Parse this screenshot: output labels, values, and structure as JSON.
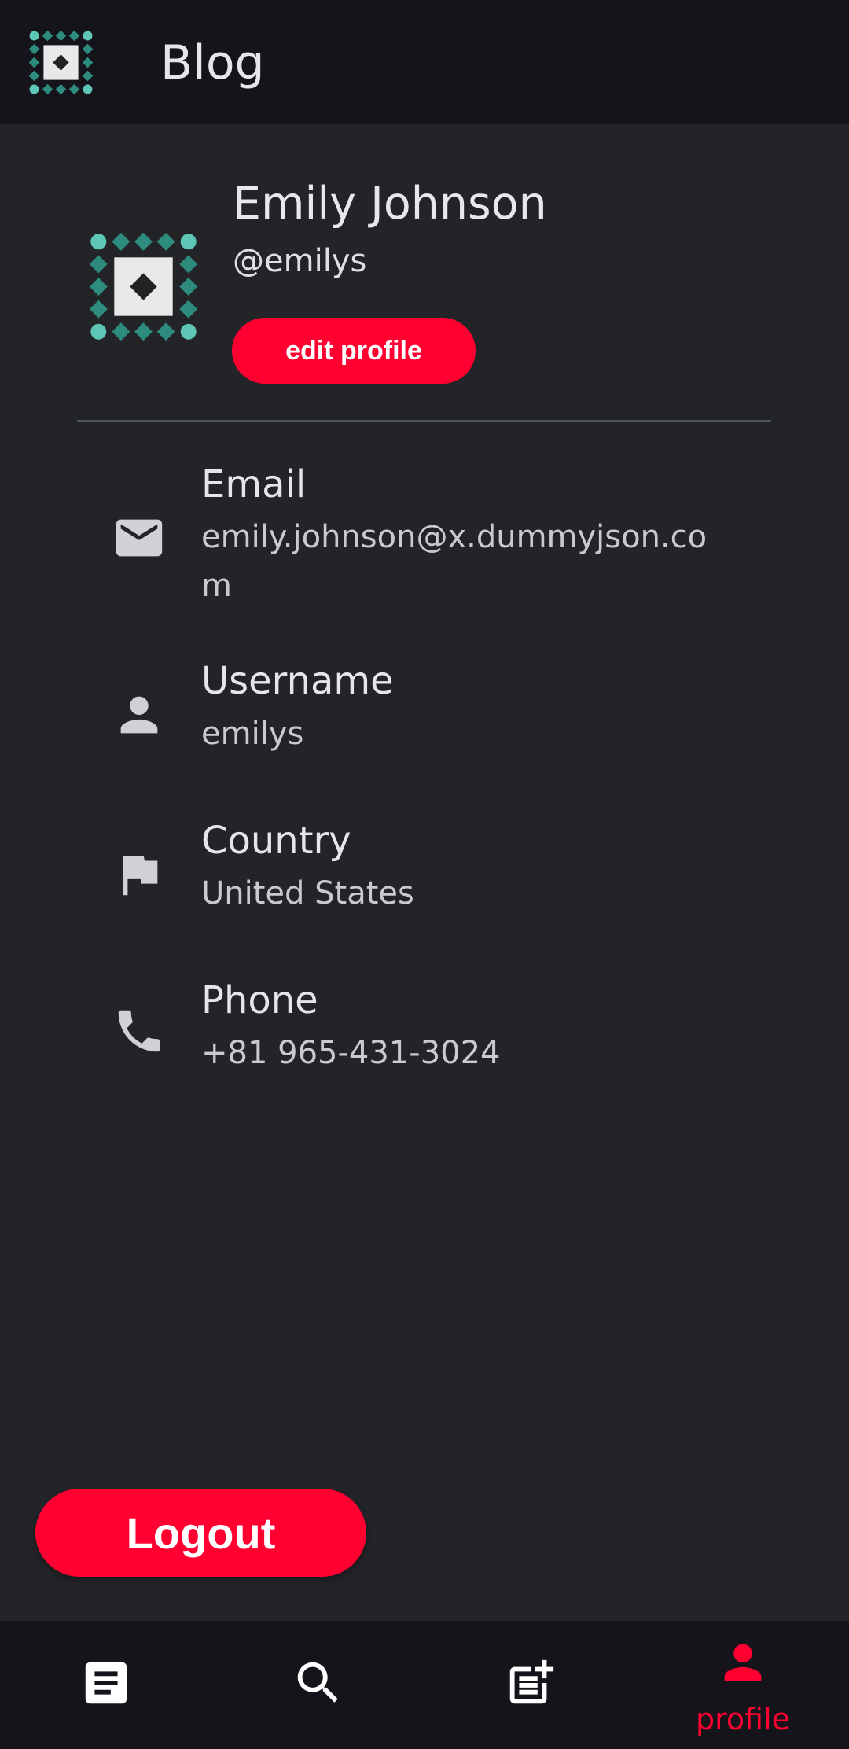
{
  "app_bar": {
    "title": "Blog",
    "logo_icon": "blog-logo-icon"
  },
  "profile": {
    "name": "Emily Johnson",
    "handle": "@emilys",
    "edit_label": "edit profile",
    "avatar_icon": "avatar-pattern-icon"
  },
  "info": [
    {
      "icon": "mail-icon",
      "label": "Email",
      "value": "emily.johnson@x.dummyjson.com"
    },
    {
      "icon": "person-icon",
      "label": "Username",
      "value": "emilys"
    },
    {
      "icon": "flag-icon",
      "label": "Country",
      "value": "United States"
    },
    {
      "icon": "phone-icon",
      "label": "Phone",
      "value": "+81 965-431-3024"
    }
  ],
  "logout_label": "Logout",
  "bottom_nav": {
    "items": [
      {
        "icon": "article-icon",
        "label": ""
      },
      {
        "icon": "search-icon",
        "label": ""
      },
      {
        "icon": "post-add-icon",
        "label": ""
      },
      {
        "icon": "person-icon",
        "label": "profile",
        "active": true
      }
    ]
  },
  "colors": {
    "accent": "#ff0030",
    "background": "#232428",
    "bar_background": "#15141a",
    "pattern_teal": "#2e8c7f",
    "pattern_light_teal": "#5ec6b6"
  }
}
